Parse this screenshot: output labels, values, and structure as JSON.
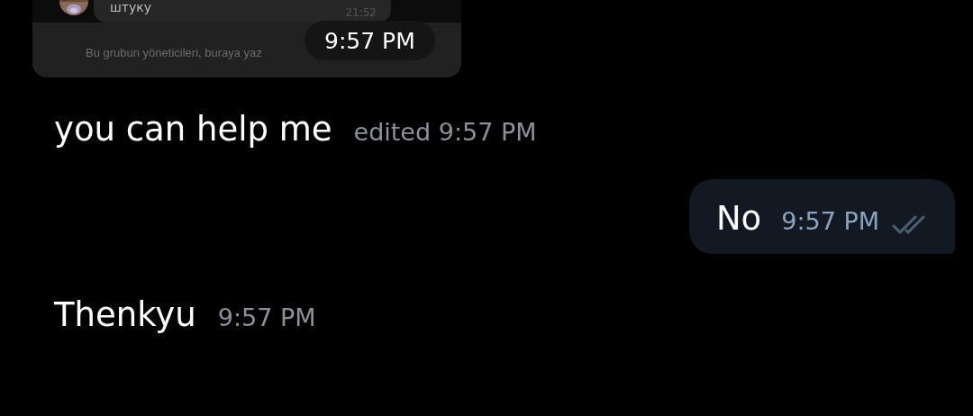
{
  "screenshot": {
    "preview_text": "штуку",
    "preview_time": "21:52",
    "notice": "Bu grubun yöneticileri, buraya yaz",
    "overlay_time": "9:57 PM"
  },
  "messages": [
    {
      "kind": "incoming",
      "text": "you can help me",
      "meta": "edited 9:57 PM"
    },
    {
      "kind": "outgoing",
      "text": "No",
      "meta": "9:57 PM",
      "read": true
    },
    {
      "kind": "incoming",
      "text": "Thenkyu",
      "meta": "9:57 PM"
    }
  ]
}
